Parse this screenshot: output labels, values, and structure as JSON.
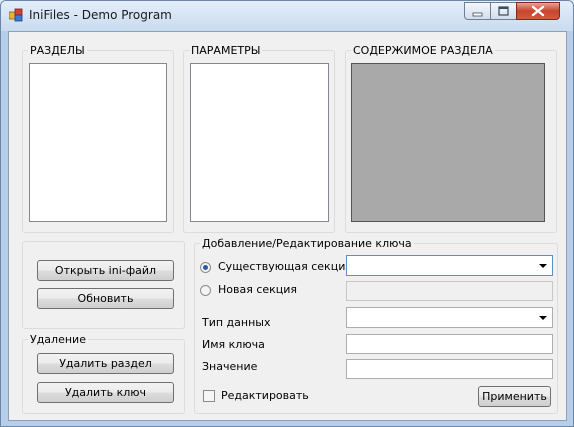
{
  "window": {
    "title": "IniFiles - Demo Program"
  },
  "sections": {
    "label": "РАЗДЕЛЫ"
  },
  "parameters": {
    "label": "ПАРАМЕТРЫ"
  },
  "contents": {
    "label": "СОДЕРЖИМОЕ РАЗДЕЛА"
  },
  "file_actions": {
    "open_label": "Открыть ini-файл",
    "refresh_label": "Обновить"
  },
  "delete": {
    "label": "Удаление",
    "delete_section_label": "Удалить раздел",
    "delete_key_label": "Удалить ключ"
  },
  "edit": {
    "label": "Добавление/Редактирование ключа",
    "existing_section_label": "Существующая секция",
    "new_section_label": "Новая секция",
    "data_type_label": "Тип данных",
    "key_name_label": "Имя ключа",
    "value_label": "Значение",
    "edit_checkbox_label": "Редактировать",
    "apply_label": "Применить",
    "existing_section_selected": true
  },
  "colors": {
    "content_gray": "#a9a9a9",
    "title_bar": "#c9dbef"
  }
}
